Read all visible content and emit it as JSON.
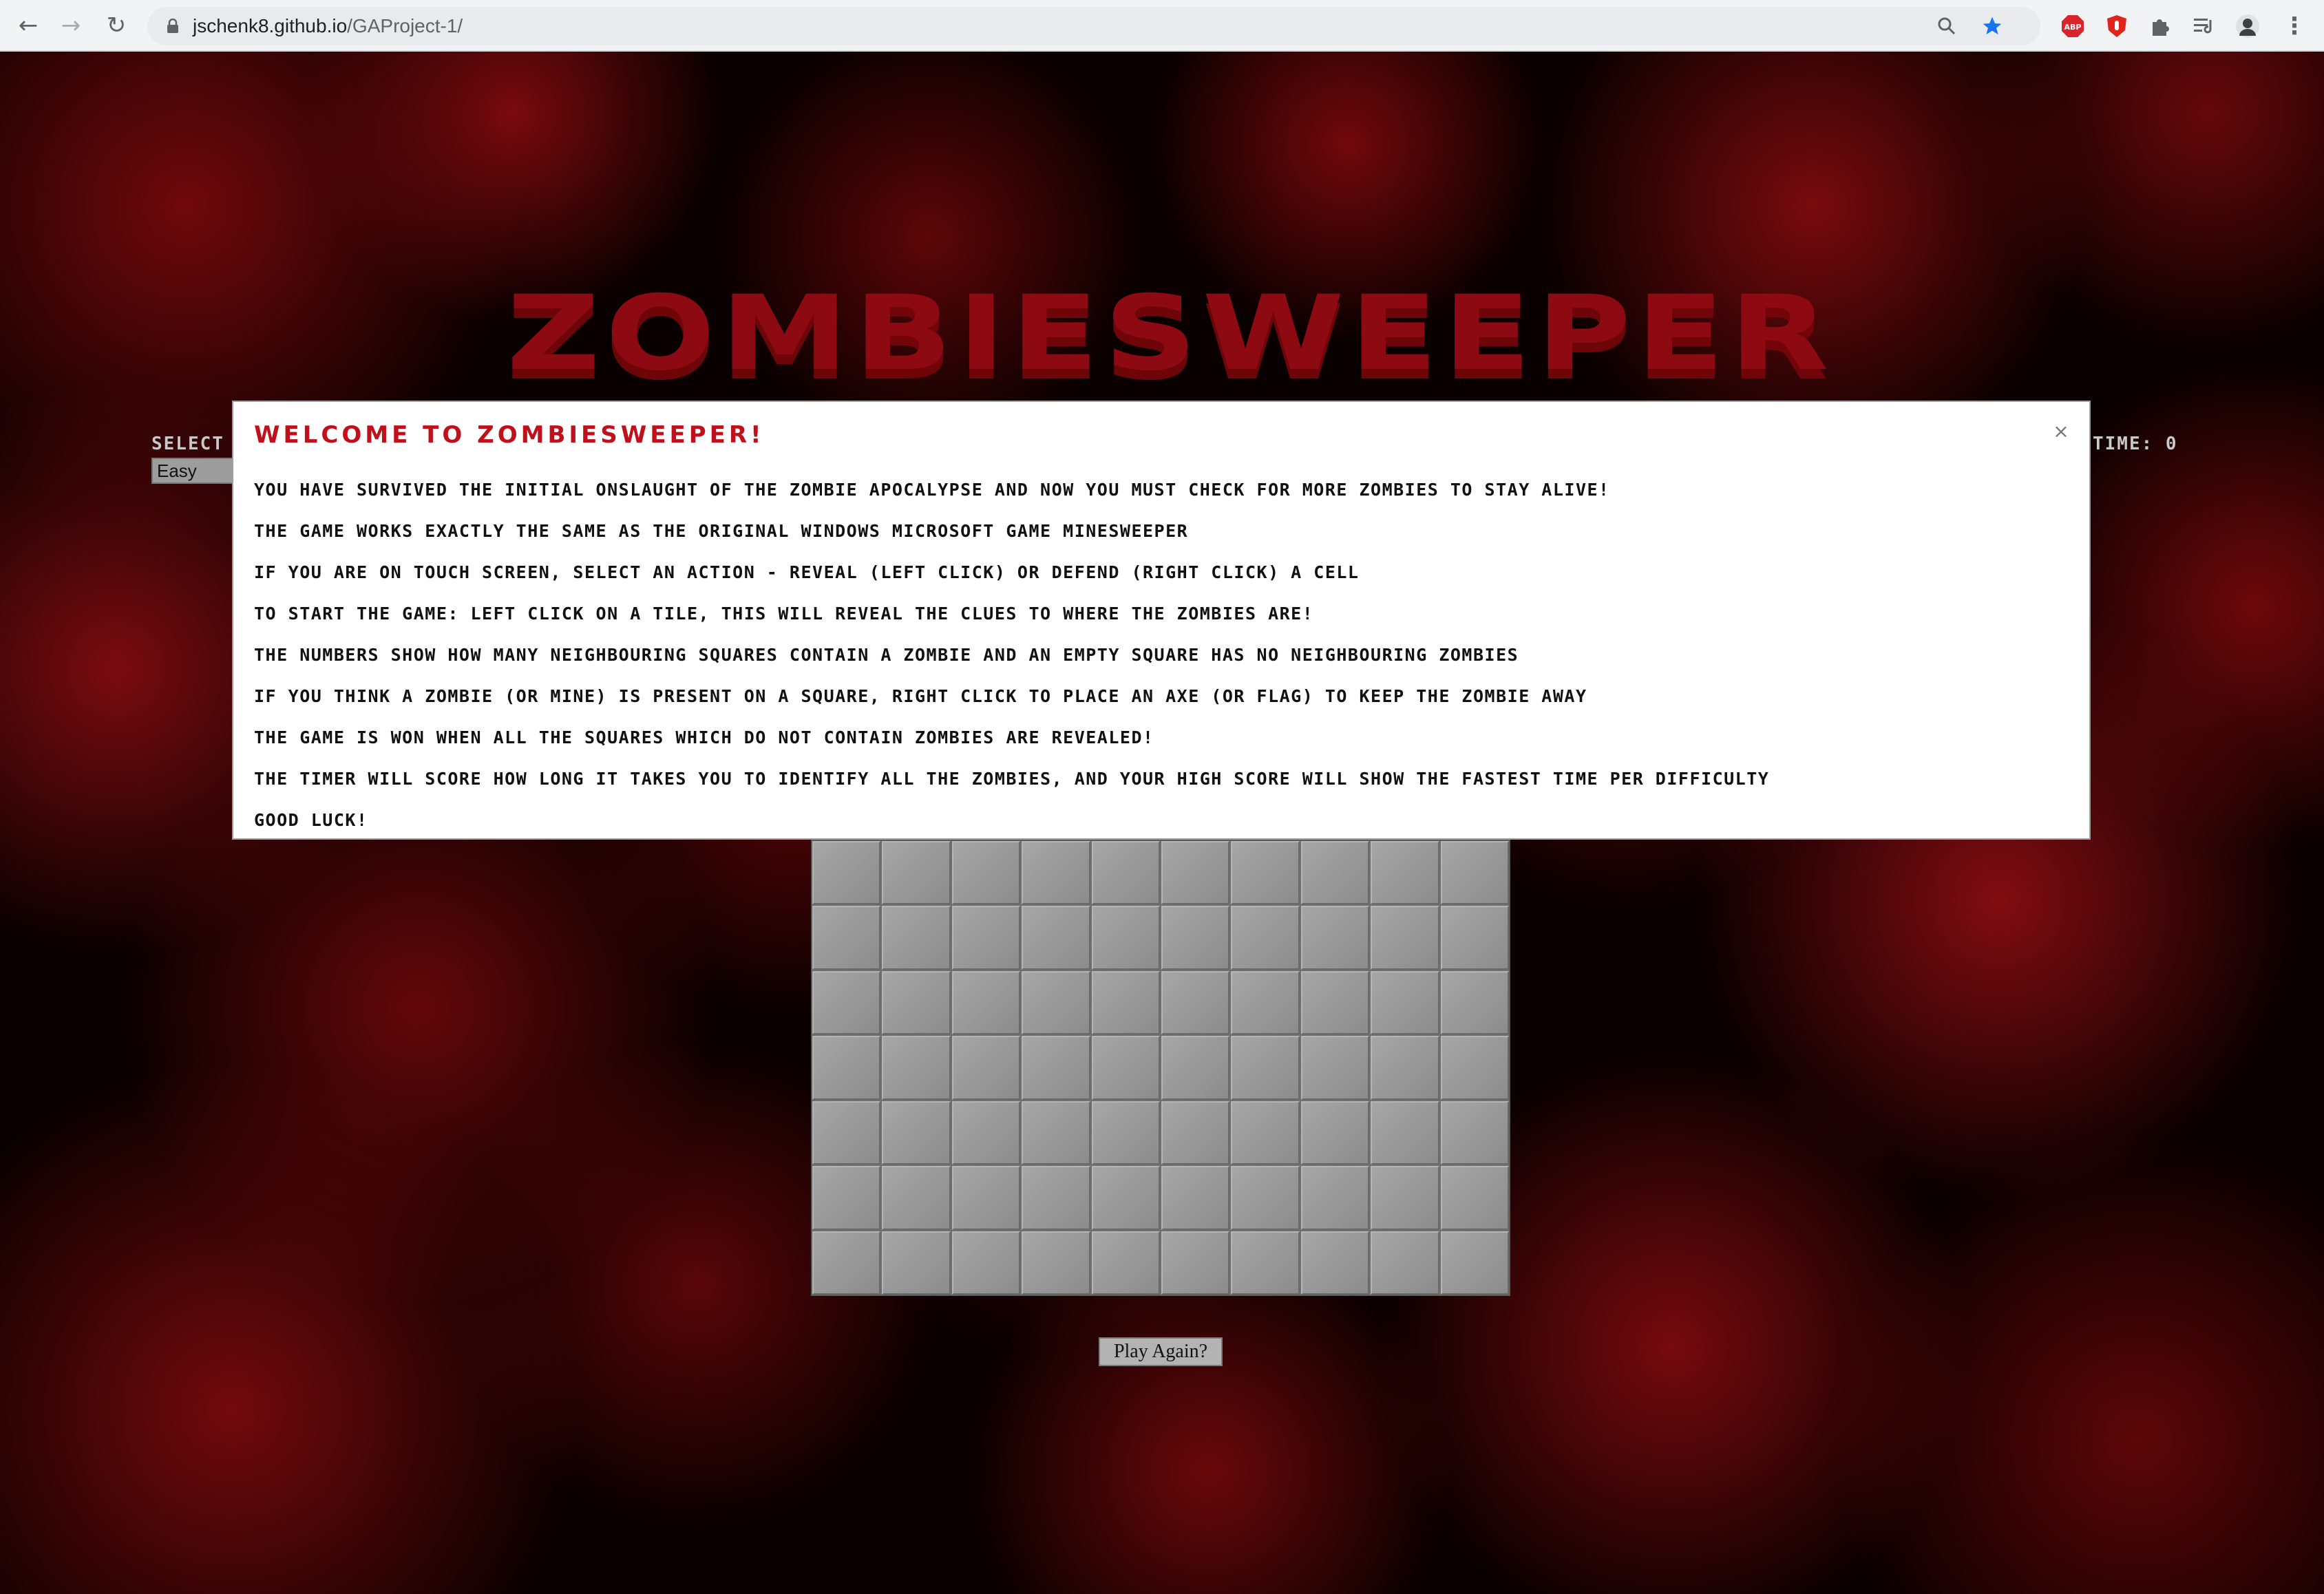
{
  "browser": {
    "url_host": "jschenk8.github.io",
    "url_path": "/GAProject-1/"
  },
  "game": {
    "title": "ZOMBIESWEEPER",
    "select_label": "SELECT DIFFICULTY",
    "difficulty_value": "Easy",
    "timer_text": "TIME: 0",
    "play_again_label": "Play Again?",
    "board": {
      "rows": 7,
      "cols": 10
    }
  },
  "modal": {
    "title": "WELCOME TO ZOMBIESWEEPER!",
    "close_glyph": "×",
    "lines": [
      "You have survived the initial onslaught of the zombie apocalypse and now you must check for more zombies to stay alive!",
      "The game works exactly the same as the original Windows Microsoft game Minesweeper",
      "If you are on touch screen, select an action - Reveal (left click) or Defend (right click) a cell",
      "To start the game: left click on a tile, this will reveal the clues to where the zombies are!",
      "The numbers show how many neighbouring squares contain a zombie and an empty square has no neighbouring zombies",
      "If you think a zombie (or mine) is present on a square, right click to place an axe (or flag) to keep the zombie away",
      "The game is won when all the squares which do not contain zombies are revealed!",
      "The timer will score how long it takes you to identify all the zombies, and your high score will show the fastest time per difficulty",
      "Good luck!"
    ]
  },
  "colors": {
    "title_red": "#8e0a12",
    "modal_title_red": "#c0101c",
    "tile_gray": "#999999"
  }
}
